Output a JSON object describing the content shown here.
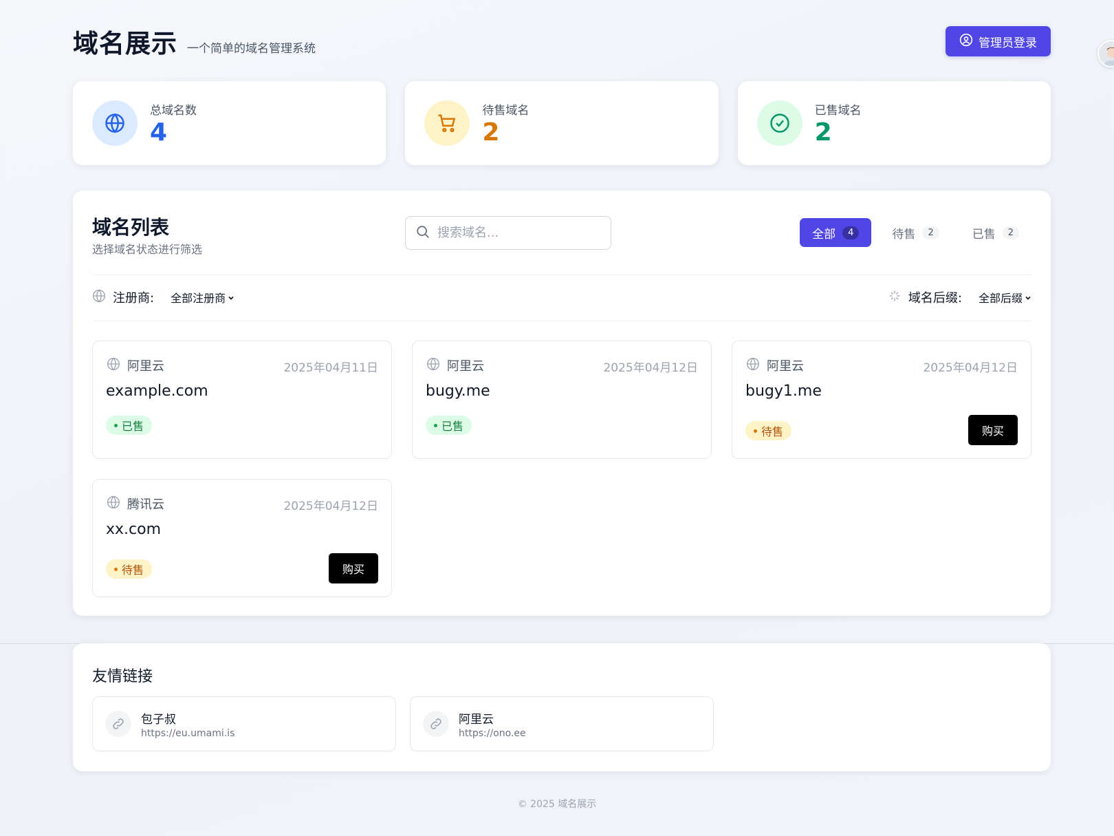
{
  "header": {
    "title": "域名展示",
    "subtitle": "一个简单的域名管理系统",
    "login_label": "管理员登录"
  },
  "stats": [
    {
      "label": "总域名数",
      "value": "4",
      "icon": "globe-icon",
      "color": "#2563eb",
      "bg": "#dbeafe"
    },
    {
      "label": "待售域名",
      "value": "2",
      "icon": "cart-icon",
      "color": "#d97706",
      "bg": "#fef3c7"
    },
    {
      "label": "已售域名",
      "value": "2",
      "icon": "check-circle-icon",
      "color": "#059669",
      "bg": "#dcfce7"
    }
  ],
  "list": {
    "title": "域名列表",
    "subtitle": "选择域名状态进行筛选",
    "search_placeholder": "搜索域名...",
    "tabs": [
      {
        "label": "全部",
        "count": "4"
      },
      {
        "label": "待售",
        "count": "2"
      },
      {
        "label": "已售",
        "count": "2"
      }
    ],
    "registrar_label": "注册商:",
    "registrar_value": "全部注册商",
    "suffix_label": "域名后缀:",
    "suffix_value": "全部后缀",
    "buy_label": "购买",
    "domains": [
      {
        "registrar": "阿里云",
        "date": "2025年04月11日",
        "domain": "example.com",
        "status": "已售"
      },
      {
        "registrar": "阿里云",
        "date": "2025年04月12日",
        "domain": "bugy.me",
        "status": "已售"
      },
      {
        "registrar": "阿里云",
        "date": "2025年04月12日",
        "domain": "bugy1.me",
        "status": "待售"
      },
      {
        "registrar": "腾讯云",
        "date": "2025年04月12日",
        "domain": "xx.com",
        "status": "待售"
      }
    ]
  },
  "friends": {
    "title": "友情链接",
    "links": [
      {
        "name": "包子叔",
        "url": "https://eu.umami.is"
      },
      {
        "name": "阿里云",
        "url": "https://ono.ee"
      }
    ]
  },
  "footer": "© 2025 域名展示",
  "colors": {
    "accent": "#4f46e5",
    "sold": "#15803d",
    "forsale": "#b45309"
  }
}
